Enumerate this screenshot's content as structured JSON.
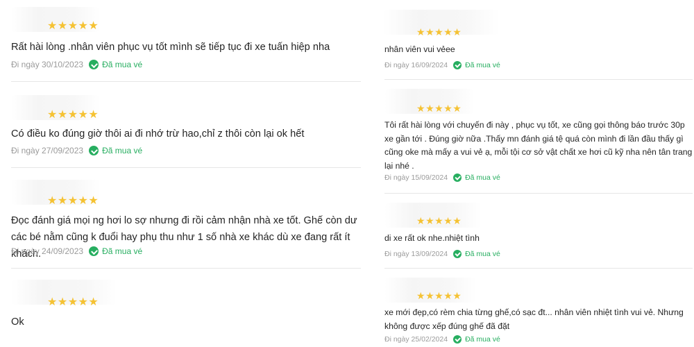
{
  "colors": {
    "star": "#f5c233",
    "verified": "#27ae60",
    "date": "#9a9a9a"
  },
  "icons": {
    "rating": "star-icon",
    "verified": "check-circle-icon"
  },
  "left_reviews": [
    {
      "rating": 5,
      "text": "Rất hài lòng .nhân viên phục vụ tốt mình sẽ tiếp tục đi xe tuấn hiệp nha",
      "date": "Đi ngày 30/10/2023",
      "badge": "Đã mua vé"
    },
    {
      "rating": 5,
      "text": "Có điều ko đúng giờ thôi ai đi nhớ trừ hao,chỉ z thôi còn lại ok hết",
      "date": "Đi ngày 27/09/2023",
      "badge": "Đã mua vé"
    },
    {
      "rating": 5,
      "text": "Đọc đánh giá mọi ng hơi lo sợ nhưng đi rồi cảm nhận nhà xe tốt. Ghế còn dư các bé nằm cũng k đuổi hay phụ thu như 1 số nhà xe khác dù xe đang rất ít khách.",
      "date": "Đi ngày 24/09/2023",
      "badge": "Đã mua vé"
    },
    {
      "rating": 5,
      "text": "Ok"
    }
  ],
  "right_reviews": [
    {
      "rating": 5,
      "text": "nhân viên vui vẻee",
      "date": "Đi ngày 16/09/2024",
      "badge": "Đã mua vé"
    },
    {
      "rating": 5,
      "text": "Tôi rất hài lòng với chuyến đi này , phục vụ tốt, xe cũng gọi thông báo trước 30p xe gần tới . Đúng giờ nữa .Thấy mn đánh giá tệ quá còn mình đi lần đầu thấy gì cũng oke mà mấy a vui vẻ ạ, mỗi tội cơ sở vật chất xe hơi cũ kỹ nha nên tân trang lại nhé .",
      "date": "Đi ngày 15/09/2024",
      "badge": "Đã mua vé"
    },
    {
      "rating": 5,
      "text": "di xe rất ok nhe.nhiệt tình",
      "date": "Đi ngày 13/09/2024",
      "badge": "Đã mua vé"
    },
    {
      "rating": 5,
      "text": "xe mới đẹp,có rèm chia từng ghế,có sạc đt... nhân viên nhiệt tình vui vẻ. Nhưng không được xếp đúng ghế đã đặt",
      "date": "Đi ngày 25/02/2024",
      "badge": "Đã mua vé"
    }
  ]
}
